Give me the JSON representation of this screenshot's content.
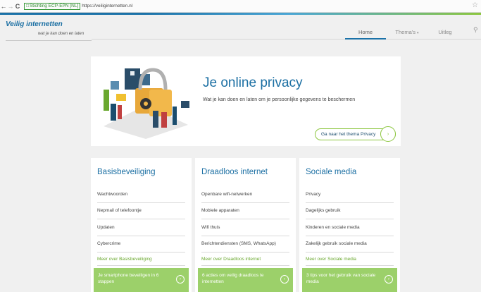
{
  "browser": {
    "back_icon": "back-arrow-icon",
    "forward_icon": "forward-arrow-icon",
    "reload_icon": "reload-icon",
    "secure_label": "Stichting ECP-EPN [NL]",
    "url": "https://veiliginternetten.nl",
    "star_icon": "star-icon"
  },
  "site": {
    "logo_title": "Veilig internetten",
    "logo_tagline": "wat je kan doen en laten",
    "menu": {
      "home": "Home",
      "themas": "Thema's",
      "uitleg": "Uitleg"
    },
    "accent_color": "#1b72a8",
    "green_color": "#8cc63f"
  },
  "hero": {
    "title": "Je online privacy",
    "subtitle": "Wat je kan doen en laten om je persoonlijke gegevens te beschermen",
    "button_label": "Ga naar het thema Privacy"
  },
  "cards": [
    {
      "title": "Basisbeveiliging",
      "items": [
        "Wachtwoorden",
        "Nepmail of telefoontje",
        "Updaten",
        "Cybercrime"
      ],
      "more": "Meer over Basisbeveiliging",
      "promo": "Je smartphone beveiligen in 6 stappen"
    },
    {
      "title": "Draadloos internet",
      "items": [
        "Openbare wifi-netwerken",
        "Mobiele apparaten",
        "Wifi thuis",
        "Berichtendiensten (SMS, WhatsApp)"
      ],
      "more": "Meer over Draadloos internet",
      "promo": "6 acties om veilig draadloos te internetten"
    },
    {
      "title": "Sociale media",
      "items": [
        "Privacy",
        "Dagelijks gebruik",
        "Kinderen en sociale media",
        "Zakelijk gebruik sociale media"
      ],
      "more": "Meer over Sociale media",
      "promo": "3 tips voor het gebruik van sociale media"
    }
  ]
}
